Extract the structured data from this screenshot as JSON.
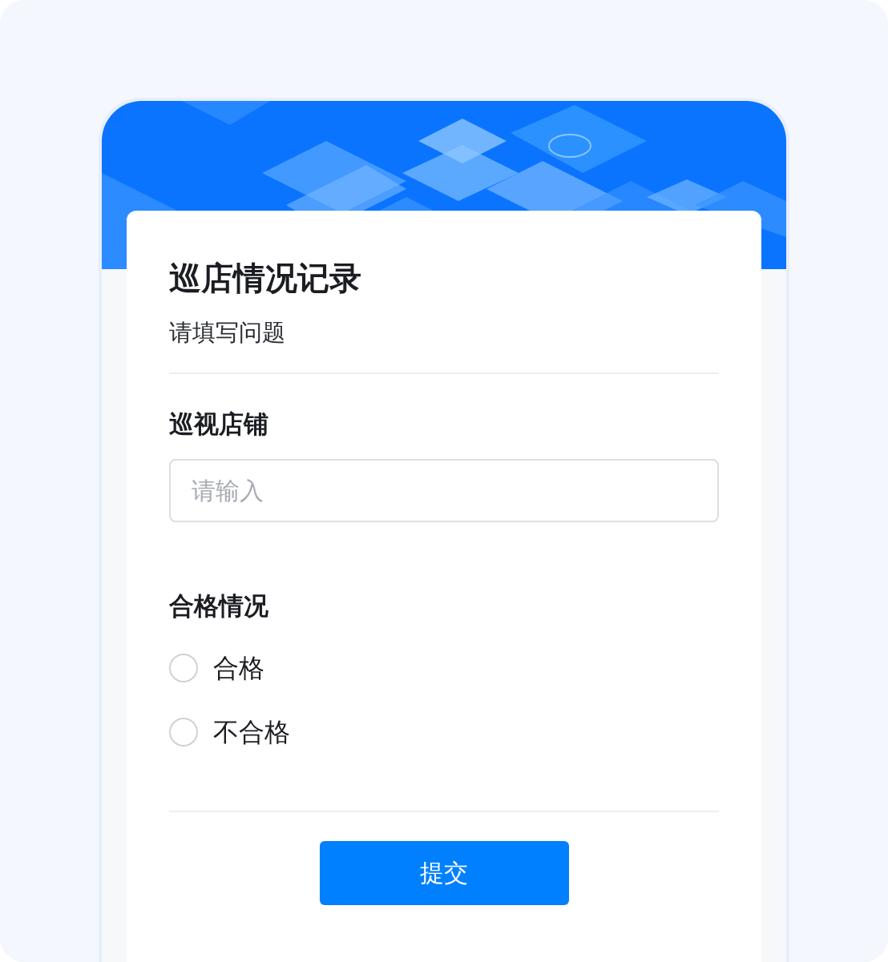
{
  "form": {
    "title": "巡店情况记录",
    "subtitle": "请填写问题",
    "fields": [
      {
        "kind": "text",
        "label": "巡视店铺",
        "placeholder": "请输入"
      },
      {
        "kind": "radio",
        "label": "合格情况",
        "options": [
          {
            "label": "合格",
            "selected": false
          },
          {
            "label": "不合格",
            "selected": false
          }
        ]
      }
    ],
    "submit": "提交"
  }
}
